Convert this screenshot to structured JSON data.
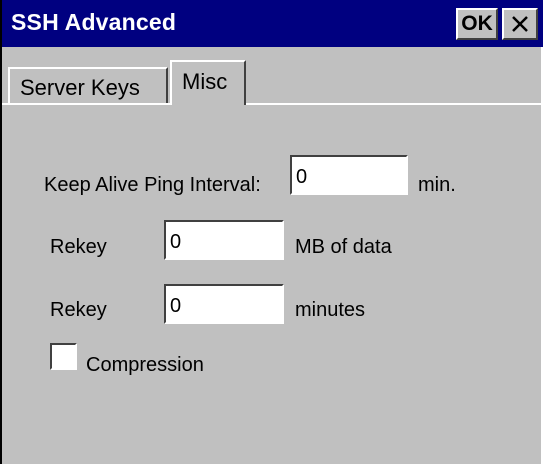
{
  "window": {
    "title": "SSH Advanced",
    "ok_label": "OK"
  },
  "tabs": [
    {
      "label": "Server Keys",
      "active": false
    },
    {
      "label": "Misc",
      "active": true
    }
  ],
  "form": {
    "keep_alive": {
      "label": "Keep Alive Ping Interval:",
      "value": "0",
      "unit": "min."
    },
    "rekey_data": {
      "label": "Rekey",
      "value": "0",
      "unit": "MB of data"
    },
    "rekey_minutes": {
      "label": "Rekey",
      "value": "0",
      "unit": "minutes"
    },
    "compression": {
      "label": "Compression",
      "checked": false
    }
  },
  "colors": {
    "titlebar": "#000080",
    "face": "#c0c0c0"
  },
  "icons": {
    "close": "close-icon"
  }
}
